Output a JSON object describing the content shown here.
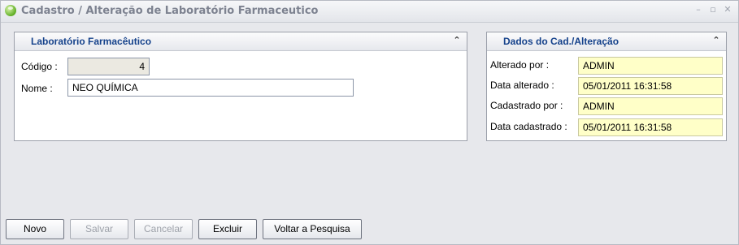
{
  "window": {
    "title": "Cadastro / Alteração de Laboratório Farmaceutico",
    "controls": [
      "–",
      "▫",
      "✕"
    ]
  },
  "lab_panel": {
    "title": "Laboratório Farmacêutico",
    "codigo_label": "Código :",
    "codigo_value": "4",
    "nome_label": "Nome :",
    "nome_value": "NEO QUÍMICA"
  },
  "audit_panel": {
    "title": "Dados do Cad./Alteração",
    "fields": [
      {
        "label": "Alterado por :",
        "value": "ADMIN"
      },
      {
        "label": "Data alterado :",
        "value": "05/01/2011 16:31:58"
      },
      {
        "label": "Cadastrado por :",
        "value": "ADMIN"
      },
      {
        "label": "Data cadastrado :",
        "value": "05/01/2011 16:31:58"
      }
    ]
  },
  "buttons": {
    "novo": "Novo",
    "salvar": "Salvar",
    "cancelar": "Cancelar",
    "excluir": "Excluir",
    "voltar": "Voltar a Pesquisa"
  },
  "colors": {
    "header_title": "#15428b",
    "readonly_fill": "#ebe9e1",
    "audit_fill": "#ffffc8"
  }
}
